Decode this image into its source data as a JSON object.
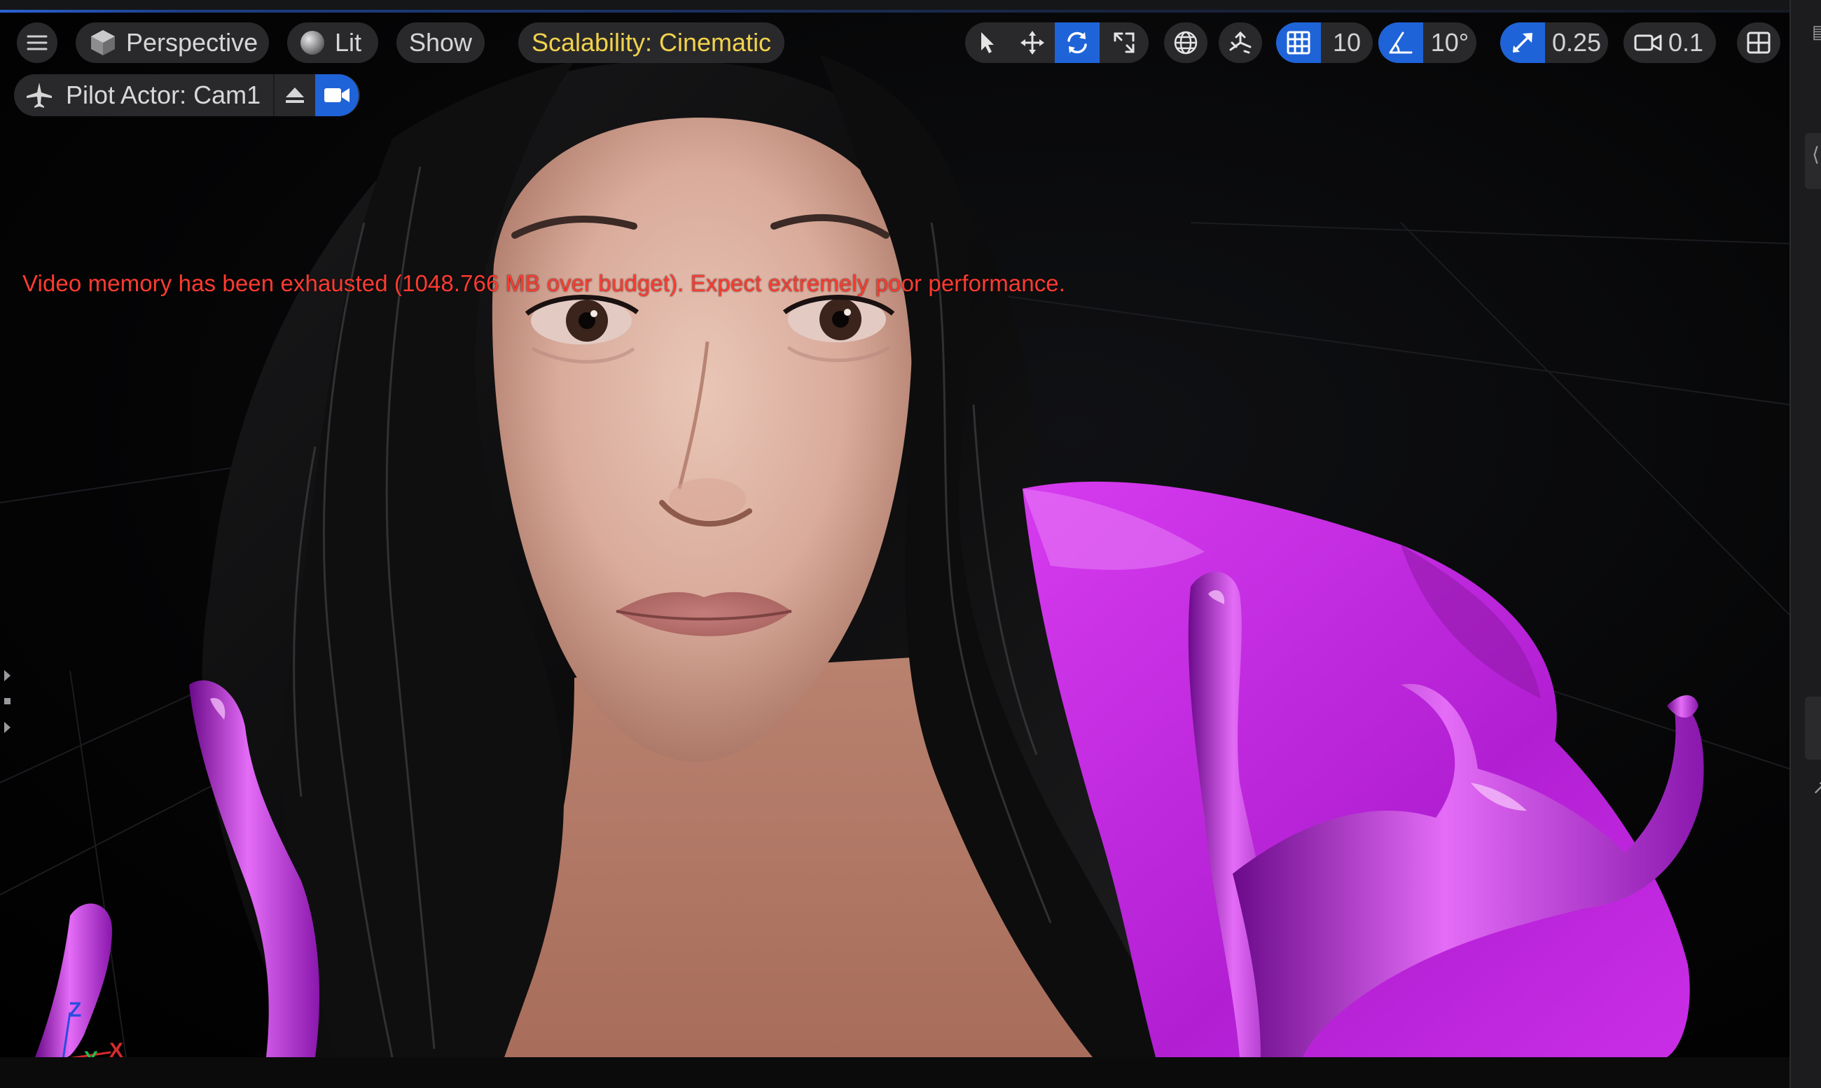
{
  "toolbar": {
    "viewport_mode": "Perspective",
    "lighting_mode": "Lit",
    "show_label": "Show",
    "scalability_label": "Scalability: Cinematic",
    "grid_snap_value": "10",
    "rotation_snap_value": "10°",
    "scale_snap_value": "0.25",
    "camera_speed_value": "0.1"
  },
  "pilot": {
    "label": "Pilot Actor: Cam1"
  },
  "viewport": {
    "warning": "Video memory has been exhausted (1048.766 MB over budget). Expect extremely poor performance.",
    "axis_labels": {
      "z": "Z",
      "y": "Y",
      "x": "X"
    }
  },
  "colors": {
    "accent_blue": "#1f63d8",
    "scalability_text": "#f2d24c",
    "warning_red": "#ff3b30",
    "magenta_liquid": "#c323e0"
  },
  "icons": {
    "menu": "hamburger-icon",
    "perspective": "cube-icon",
    "lit": "sphere-icon",
    "select": "cursor-icon",
    "translate": "move-icon",
    "rotate": "rotate-icon",
    "scale": "scale-icon",
    "world_local": "globe-icon",
    "surface_snap": "surface-snap-icon",
    "grid_snap": "grid-icon",
    "rotation_snap": "angle-icon",
    "scale_snap": "scale-arrow-icon",
    "camera_speed": "camera-icon",
    "layout": "layout-icon",
    "pilot": "airplane-icon",
    "eject": "eject-icon",
    "camera_view": "camera-view-icon"
  }
}
